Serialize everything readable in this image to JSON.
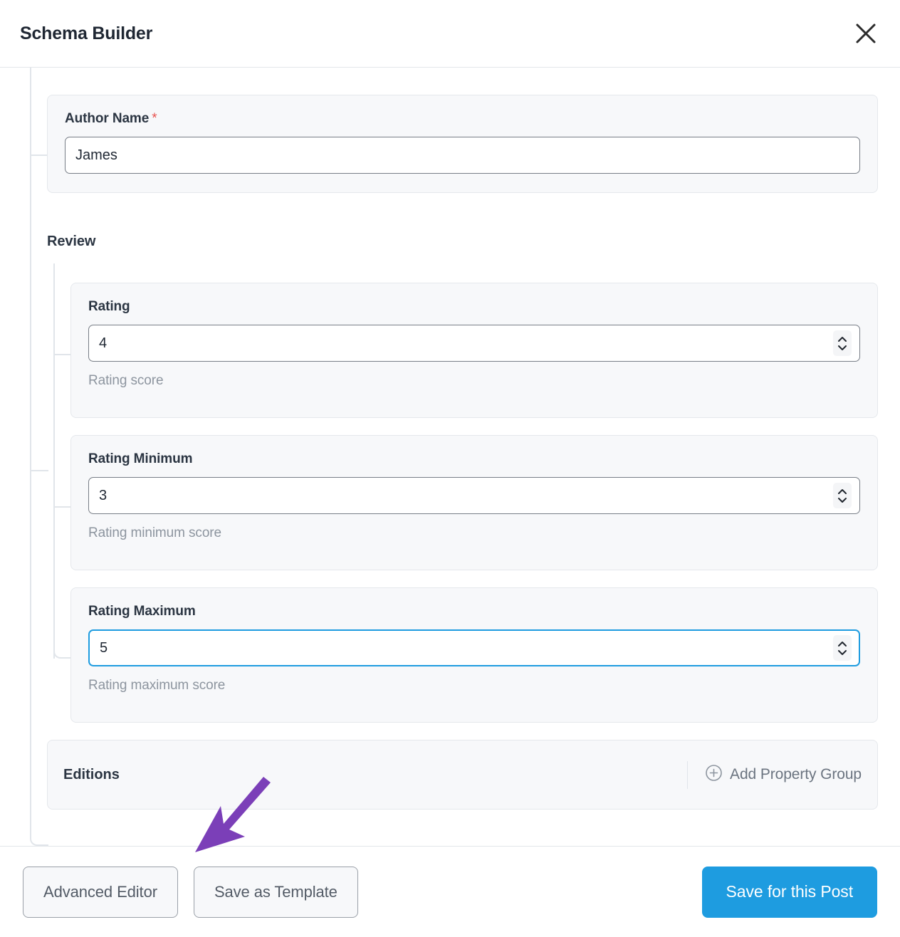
{
  "header": {
    "title": "Schema Builder",
    "close_icon": "close-icon"
  },
  "fields": {
    "author_name": {
      "label": "Author Name",
      "required_marker": "*",
      "value": "James",
      "placeholder": ""
    }
  },
  "groups": [
    {
      "heading": "Review",
      "properties": [
        {
          "label": "Rating",
          "value": "4",
          "help": "Rating score",
          "focused": false,
          "spinner_icon": "stepper-icon"
        },
        {
          "label": "Rating Minimum",
          "value": "3",
          "help": "Rating minimum score",
          "focused": false,
          "spinner_icon": "stepper-icon"
        },
        {
          "label": "Rating Maximum",
          "value": "5",
          "help": "Rating maximum score",
          "focused": true,
          "spinner_icon": "stepper-icon"
        }
      ]
    }
  ],
  "editions": {
    "title": "Editions",
    "add_group_label": "Add Property Group",
    "add_group_icon": "plus-circle-icon"
  },
  "footer": {
    "advanced_editor_label": "Advanced Editor",
    "save_template_label": "Save as Template",
    "save_post_label": "Save for this Post"
  },
  "annotation": {
    "arrow_icon": "arrow-pointer-icon",
    "arrow_color": "#7b3fb8"
  },
  "colors": {
    "accent": "#1e9ce0",
    "focus_border": "#1e9ce0",
    "required": "#e8534f",
    "card_bg": "#f7f8fa",
    "tree_line": "#e1e5ea",
    "annotation": "#7b3fb8"
  }
}
